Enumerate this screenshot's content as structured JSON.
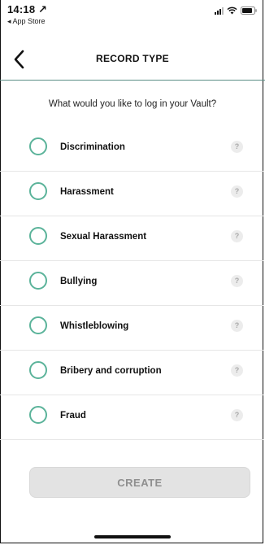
{
  "status_bar": {
    "time": "14:18 ↗",
    "back_app": "◂ App Store",
    "icons": [
      "signal-icon",
      "wifi-icon",
      "battery-icon"
    ]
  },
  "header": {
    "back_icon": "chevron-left-icon",
    "title": "RECORD TYPE"
  },
  "prompt": "What would you like to log in your Vault?",
  "options": [
    {
      "label": "Discrimination",
      "help": "?"
    },
    {
      "label": "Harassment",
      "help": "?"
    },
    {
      "label": "Sexual Harassment",
      "help": "?"
    },
    {
      "label": "Bullying",
      "help": "?"
    },
    {
      "label": "Whistleblowing",
      "help": "?"
    },
    {
      "label": "Bribery and corruption",
      "help": "?"
    },
    {
      "label": "Fraud",
      "help": "?"
    }
  ],
  "create_button": {
    "label": "CREATE",
    "enabled": false
  },
  "colors": {
    "accent": "#5bb39a",
    "header_divider": "#5b8f86",
    "button_bg": "#e3e3e3",
    "button_text": "#8f8f8f"
  }
}
